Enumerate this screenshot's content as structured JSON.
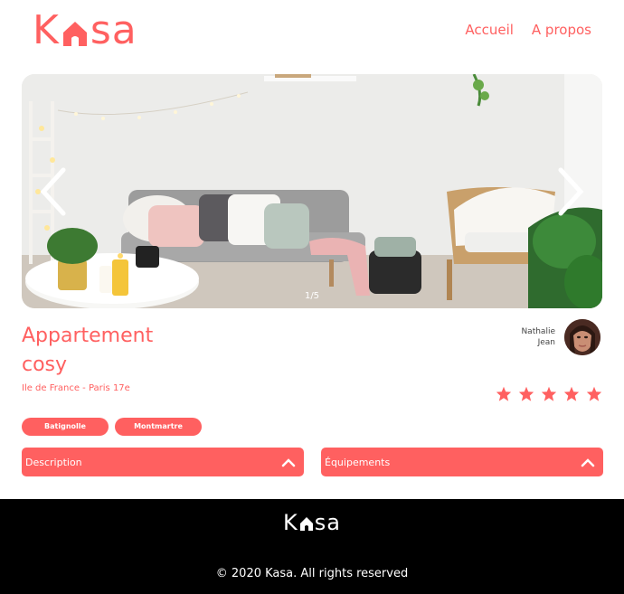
{
  "brand": {
    "logo_left": "K",
    "logo_right": "sa",
    "accent_color": "#FF6060"
  },
  "nav": {
    "items": [
      {
        "label": "Accueil"
      },
      {
        "label": "A propos"
      }
    ]
  },
  "carousel": {
    "counter": "1/5",
    "prev_icon": "chevron-left-icon",
    "next_icon": "chevron-right-icon"
  },
  "listing": {
    "title": "Appartement cosy",
    "location": "Ile de France - Paris 17e",
    "tags": [
      {
        "label": "Batignolle"
      },
      {
        "label": "Montmartre"
      }
    ],
    "host": {
      "first_name": "Nathalie",
      "last_name": "Jean"
    },
    "rating": {
      "value": 5,
      "max": 5
    }
  },
  "collapses": [
    {
      "label": "Description"
    },
    {
      "label": "Équipements"
    }
  ],
  "footer": {
    "logo_left": "K",
    "logo_right": "sa",
    "copyright": "© 2020 Kasa. All rights reserved"
  }
}
